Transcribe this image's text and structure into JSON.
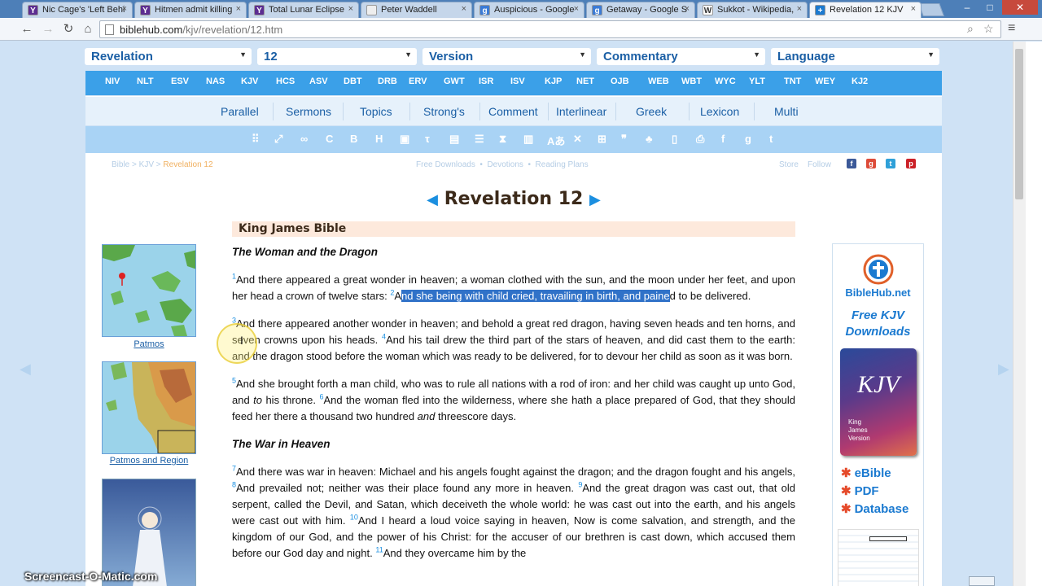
{
  "browser": {
    "tabs": [
      {
        "title": "Nic Cage's 'Left Behi",
        "icon": "Y",
        "color": "#5c2d91"
      },
      {
        "title": "Hitmen admit killing",
        "icon": "Y",
        "color": "#5c2d91"
      },
      {
        "title": "Total Lunar Eclipse",
        "icon": "Y",
        "color": "#5c2d91"
      },
      {
        "title": "Peter Waddell",
        "icon": "page",
        "color": "#eeeeee"
      },
      {
        "title": "Auspicious - Google",
        "icon": "g",
        "color": "#3b7bd6"
      },
      {
        "title": "Getaway - Google S",
        "icon": "g",
        "color": "#3b7bd6"
      },
      {
        "title": "Sukkot - Wikipedia,",
        "icon": "W",
        "color": "#ffffff"
      },
      {
        "title": "Revelation 12 KJV",
        "icon": "+",
        "color": "#1b7ad0"
      }
    ],
    "url_host": "biblehub.com",
    "url_path": "/kjv/revelation/12.htm"
  },
  "selectors": {
    "book": "Revelation",
    "chapter": "12",
    "version": "Version",
    "commentary": "Commentary",
    "language": "Language"
  },
  "versions": [
    "NIV",
    "NLT",
    "ESV",
    "NAS",
    "KJV",
    "HCS",
    "ASV",
    "DBT",
    "DRB",
    "ERV",
    "GWT",
    "ISR",
    "ISV",
    "KJP",
    "NET",
    "OJB",
    "WEB",
    "WBT",
    "WYC",
    "YLT",
    "TNT",
    "WEY",
    "KJ2"
  ],
  "links": [
    "Parallel",
    "Sermons",
    "Topics",
    "Strong's",
    "Comment",
    "Interlinear",
    "Greek",
    "Lexicon",
    "Multi"
  ],
  "breadcrumb": {
    "bible": "Bible",
    "sep": ">",
    "kjv": "KJV",
    "current": "Revelation 12"
  },
  "midlinks": {
    "downloads": "Free Downloads",
    "devotions": "Devotions",
    "plans": "Reading Plans"
  },
  "share": {
    "store": "Store",
    "follow": "Follow"
  },
  "chapter_title": "Revelation 12",
  "version_heading": "King James Bible",
  "sections": [
    {
      "heading": "The Woman and the Dragon",
      "paragraphs": [
        [
          {
            "n": "1",
            "t": "And there appeared a great wonder in heaven; a woman clothed with the sun, and the moon under her feet, and upon her head a crown of twelve stars: "
          },
          {
            "n": "2",
            "t": "A",
            "hl": "nd she being with child cried, travailing in birth, and paine",
            "t2": "d to be delivered."
          }
        ],
        [
          {
            "n": "3",
            "t": "And there appeared another wonder in heaven; and behold a great red dragon, having seven heads and ten horns, and seven crowns upon his heads. "
          },
          {
            "n": "4",
            "t": "And his tail drew the third part of the stars of heaven, and did cast them to the earth: and the dragon stood before the woman which was ready to be delivered, for to devour her child as soon as it was born."
          }
        ],
        [
          {
            "n": "5",
            "t": "And she brought forth a man child, who was to rule all nations with a rod of iron: and her child was caught up unto God, and ",
            "i": "to",
            "t2": " his throne. "
          },
          {
            "n": "6",
            "t": "And the woman fled into the wilderness, where she hath a place prepared of God, that they should feed her there a thousand two hundred ",
            "i": "and",
            "t2": " threescore days."
          }
        ]
      ]
    },
    {
      "heading": "The War in Heaven",
      "paragraphs": [
        [
          {
            "n": "7",
            "t": "And there was war in heaven: Michael and his angels fought against the dragon; and the dragon fought and his angels, "
          },
          {
            "n": "8",
            "t": "And prevailed not; neither was their place found any more in heaven. "
          },
          {
            "n": "9",
            "t": "And the great dragon was cast out, that old serpent, called the Devil, and Satan, which deceiveth the whole world: he was cast out into the earth, and his angels were cast out with him. "
          },
          {
            "n": "10",
            "t": "And I heard a loud voice saying in heaven, Now is come salvation, and strength, and the kingdom of our God, and the power of his Christ: for the accuser of our brethren is cast down, which accused them before our God day and night. "
          },
          {
            "n": "11",
            "t": "And they overcame him by the"
          }
        ]
      ]
    }
  ],
  "maps": {
    "first_label": "Patmos",
    "second_label": "Patmos and Region"
  },
  "ad": {
    "site": "BibleHub.net",
    "free_line1": "Free KJV",
    "free_line2": "Downloads",
    "book_title": "KJV",
    "book_sub1": "King",
    "book_sub2": "James",
    "book_sub3": "Version",
    "items": [
      "eBible",
      "PDF",
      "Database"
    ]
  },
  "watermark": "Screencast-O-Matic.com"
}
